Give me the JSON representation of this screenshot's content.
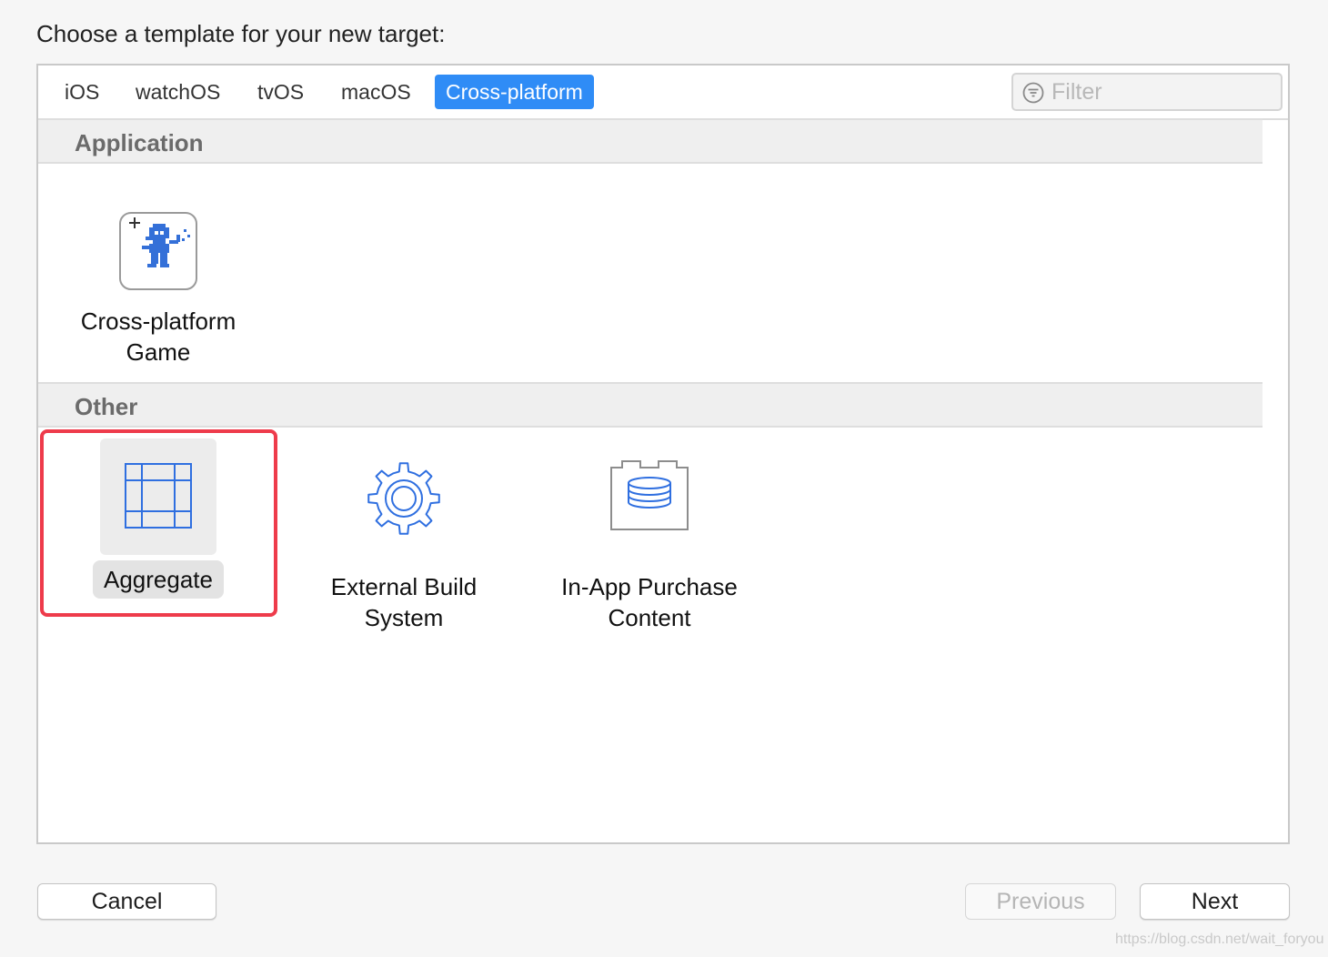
{
  "dialog": {
    "heading": "Choose a template for your new target:"
  },
  "tabs": [
    {
      "label": "iOS",
      "active": false
    },
    {
      "label": "watchOS",
      "active": false
    },
    {
      "label": "tvOS",
      "active": false
    },
    {
      "label": "macOS",
      "active": false
    },
    {
      "label": "Cross-platform",
      "active": true
    }
  ],
  "filter": {
    "placeholder": "Filter",
    "value": "",
    "icon": "filter-icon"
  },
  "sections": {
    "application": {
      "title": "Application",
      "items": [
        {
          "label_line1": "Cross-platform",
          "label_line2": "Game",
          "icon": "game-sprite-icon"
        }
      ]
    },
    "other": {
      "title": "Other",
      "items": [
        {
          "label_line1": "Aggregate",
          "icon": "aggregate-icon",
          "selected": true
        },
        {
          "label_line1": "External Build",
          "label_line2": "System",
          "icon": "gear-icon"
        },
        {
          "label_line1": "In-App Purchase",
          "label_line2": "Content",
          "icon": "in-app-purchase-icon"
        }
      ]
    }
  },
  "buttons": {
    "cancel": "Cancel",
    "previous": "Previous",
    "next": "Next"
  },
  "watermark": "https://blog.csdn.net/wait_foryou",
  "colors": {
    "accent": "#2f8cf6",
    "icon_blue": "#2f6fe0",
    "highlight_red": "#ee3b4b",
    "background": "#f6f6f6"
  }
}
